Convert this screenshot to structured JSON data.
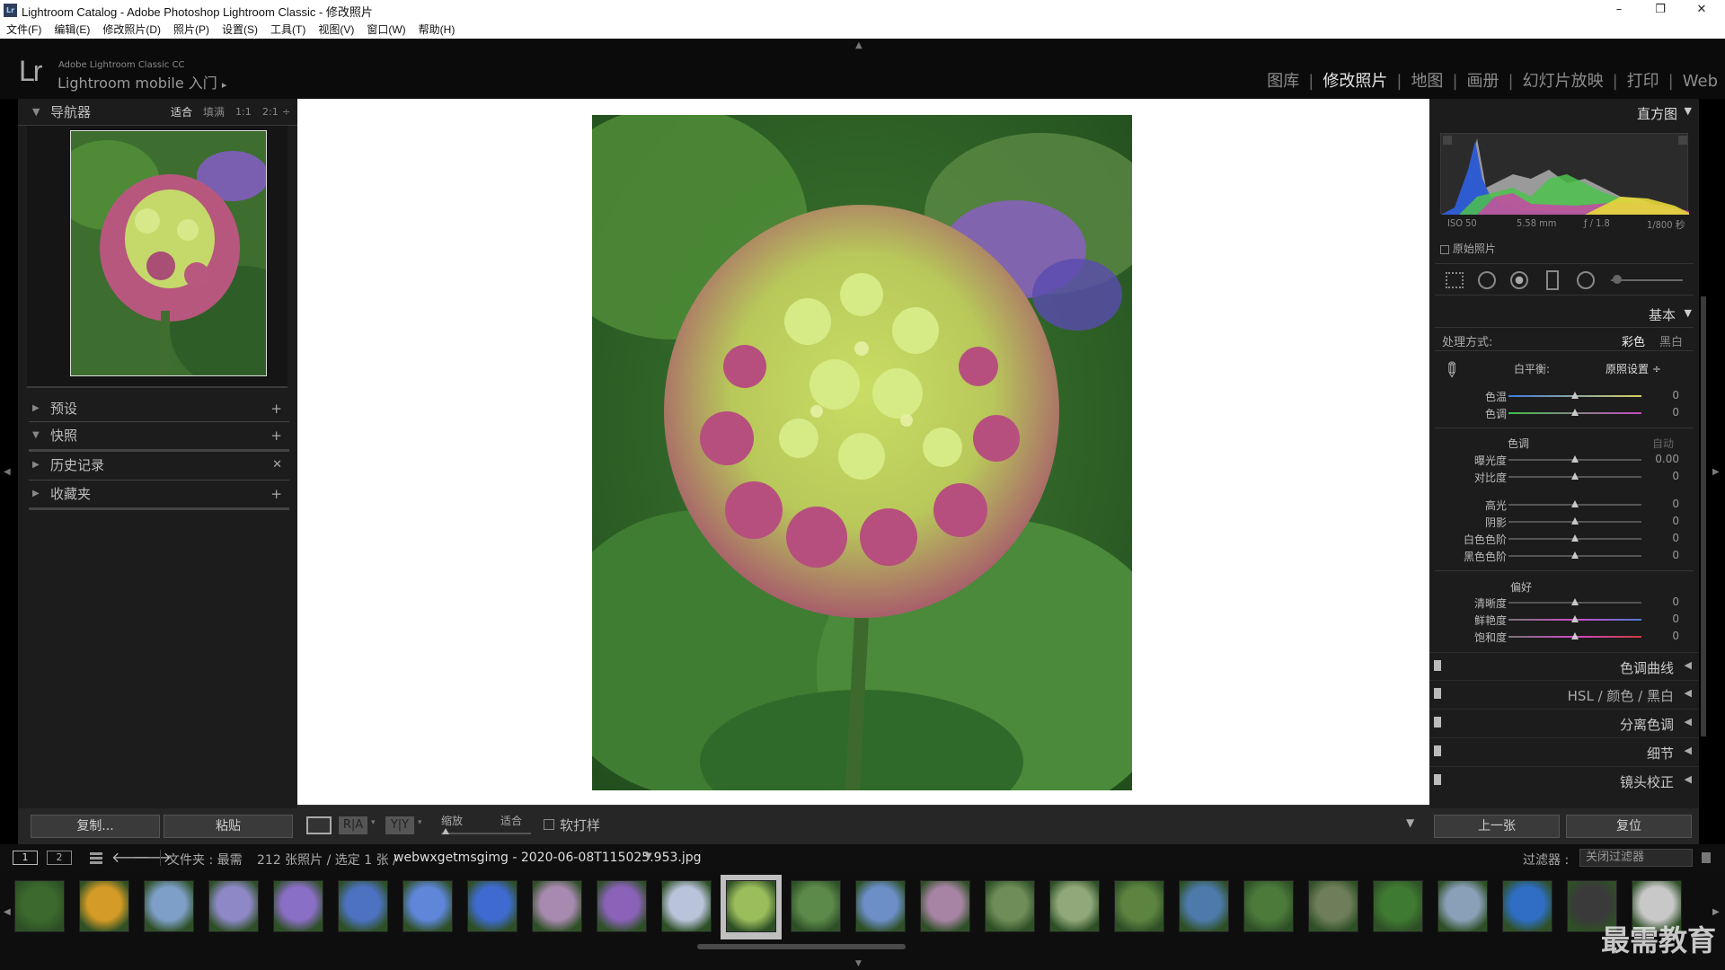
{
  "window": {
    "title": "Lightroom Catalog - Adobe Photoshop Lightroom Classic - 修改照片",
    "app_icon": "Lr",
    "controls": [
      "–",
      "❐",
      "✕"
    ]
  },
  "menu": [
    "文件(F)",
    "编辑(E)",
    "修改照片(D)",
    "照片(P)",
    "设置(S)",
    "工具(T)",
    "视图(V)",
    "窗口(W)",
    "帮助(H)"
  ],
  "header": {
    "logo": "Lr",
    "product_line1": "Adobe Lightroom Classic CC",
    "product_line2": "Lightroom mobile 入门",
    "product_arrow": "▸",
    "modules": [
      {
        "label": "图库",
        "active": false
      },
      {
        "label": "修改照片",
        "active": true
      },
      {
        "label": "地图",
        "active": false
      },
      {
        "label": "画册",
        "active": false
      },
      {
        "label": "幻灯片放映",
        "active": false
      },
      {
        "label": "打印",
        "active": false
      },
      {
        "label": "Web",
        "active": false
      }
    ]
  },
  "left_panel": {
    "navigator": {
      "title": "导航器",
      "zoom_options": [
        "适合",
        "填满",
        "1:1",
        "2:1"
      ],
      "zoom_more": "÷"
    },
    "sections": [
      {
        "label": "预设",
        "action": "+"
      },
      {
        "label": "快照",
        "action": "+"
      },
      {
        "label": "历史记录",
        "action": "✕"
      },
      {
        "label": "收藏夹",
        "action": "+"
      }
    ],
    "copy_button": "复制...",
    "paste_button": "粘贴"
  },
  "right_panel": {
    "histogram_title": "直方图",
    "histogram_meta": [
      "ISO 50",
      "5.58 mm",
      "ƒ / 1.8",
      "1/800 秒"
    ],
    "original_photo_label": "原始照片",
    "basic_title": "基本",
    "treatment_label": "处理方式:",
    "treatment_options": [
      "彩色",
      "黑白"
    ],
    "white_balance_label": "白平衡:",
    "white_balance_value": "原照设置 ÷",
    "wb_sliders": [
      {
        "label": "色温",
        "value": "0",
        "position": 0.5
      },
      {
        "label": "色调",
        "value": "0",
        "position": 0.5
      }
    ],
    "tone_title": "色调",
    "tone_auto": "自动",
    "tone_sliders": [
      {
        "label": "曝光度",
        "value": "0.00",
        "position": 0.5
      },
      {
        "label": "对比度",
        "value": "0",
        "position": 0.5
      },
      {
        "label": "高光",
        "value": "0",
        "position": 0.5
      },
      {
        "label": "阴影",
        "value": "0",
        "position": 0.5
      },
      {
        "label": "白色色阶",
        "value": "0",
        "position": 0.5
      },
      {
        "label": "黑色色阶",
        "value": "0",
        "position": 0.5
      }
    ],
    "presence_title": "偏好",
    "presence_sliders": [
      {
        "label": "清晰度",
        "value": "0",
        "position": 0.5
      },
      {
        "label": "鲜艳度",
        "value": "0",
        "position": 0.5
      },
      {
        "label": "饱和度",
        "value": "0",
        "position": 0.5
      }
    ],
    "sections": [
      {
        "label": "色调曲线"
      },
      {
        "label": "HSL / 颜色 / 黑白"
      },
      {
        "label": "分离色调"
      },
      {
        "label": "细节"
      },
      {
        "label": "镜头校正"
      }
    ],
    "prev_button": "上一张",
    "reset_button": "复位"
  },
  "toolbar": {
    "zoom_label": "缩放",
    "zoom_value": "适合",
    "softproof_label": "软打样",
    "view_buttons": [
      "R|A",
      "Y|Y"
    ]
  },
  "filmstrip_bar": {
    "monitor1": "1",
    "monitor2": "2",
    "source_text": "文件夹 : 最需",
    "count_text": "212 张照片 / 选定 1 张 /",
    "filename": "webwxgetmsgimg - 2020-06-08T115025.953.jpg",
    "filter_label": "过滤器 :",
    "filter_value": "关闭过滤器"
  },
  "filmstrip": {
    "selected_index": 11,
    "thumbs": [
      {
        "color": "#3b6a2c"
      },
      {
        "color": "#d49b26"
      },
      {
        "color": "#7ea0c8"
      },
      {
        "color": "#8e88c6"
      },
      {
        "color": "#8a6fc6"
      },
      {
        "color": "#4d72c2"
      },
      {
        "color": "#5f86d8"
      },
      {
        "color": "#3f6bd0"
      },
      {
        "color": "#a88ab0"
      },
      {
        "color": "#8a62b8"
      },
      {
        "color": "#b9c3d9"
      },
      {
        "color": "#9bbd5b"
      },
      {
        "color": "#5c8a4a"
      },
      {
        "color": "#6c8fc8"
      },
      {
        "color": "#a884a4"
      },
      {
        "color": "#6f8d58"
      },
      {
        "color": "#90a87a"
      },
      {
        "color": "#5c8440"
      },
      {
        "color": "#4d7aaa"
      },
      {
        "color": "#4c7a3b"
      },
      {
        "color": "#6e7d5a"
      },
      {
        "color": "#3f7a32"
      },
      {
        "color": "#8aa0b8"
      },
      {
        "color": "#2f6ec4"
      },
      {
        "color": "#3a3a3a"
      },
      {
        "color": "#c8c8c8"
      },
      {
        "color": "#8c8c8c"
      }
    ]
  },
  "watermark": "最需教育",
  "colors": {
    "panel_bg": "#1c1c1c",
    "header_bg": "#0b0b0b",
    "canvas_bg": "#ffffff",
    "selected_thumb": "#bfbfbf"
  }
}
